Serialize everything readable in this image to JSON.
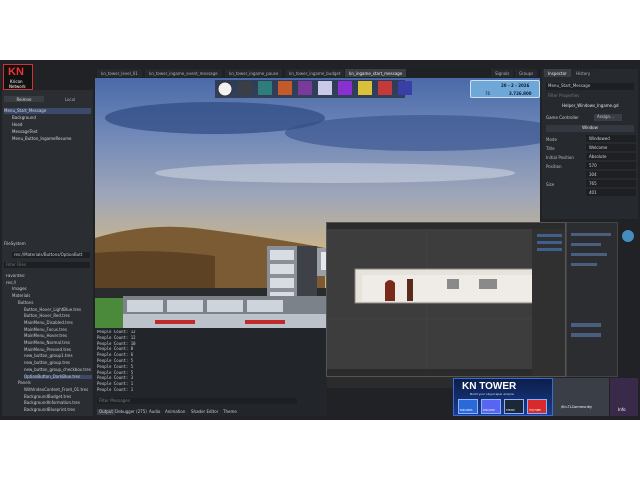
{
  "logo": {
    "line1": "KN",
    "line2": "Kricon",
    "line3": "Network"
  },
  "scene_panel": {
    "tabs": [
      "Reimne",
      "Local"
    ],
    "items": [
      "Menu_Start_Message",
      "Background",
      "Hood",
      "MessageText",
      "Menu_Button_IngameResume"
    ]
  },
  "filesystem": {
    "title": "FileSystem",
    "path": "res://Materials/Buttons/OptionButt",
    "filter": "Filter Files",
    "items": [
      "Favorites:",
      "res://",
      "Images",
      "Materials",
      "Buttons",
      "Button_Hover_LightBlue.tres",
      "Button_Hover_Red.tres",
      "MainMenu_Disabled.tres",
      "MainMenu_Focus.tres",
      "MainMenu_Hover.tres",
      "MainMenu_Normal.tres",
      "MainMenu_Pressed.tres",
      "new_button_group1.tres",
      "new_button_group.tres",
      "new_button_group_checkbox.tres",
      "OptionButton_DarkBlue.tres",
      "Panels",
      "WithIndexContent_Front_01.tres",
      "BackgroundBudget.tres",
      "BackgroundInformation.tres",
      "BackgroundBlueprint.tres"
    ]
  },
  "editor_tabs": [
    "kn_tower_level_01",
    "kn_tower_ingame_event_message",
    "kn_tower_ingame_pause",
    "kn_tower_ingame_budget",
    "kn_ingame_start_message"
  ],
  "top_right_tabs": [
    "Signals",
    "Groups"
  ],
  "hud": {
    "date": "20 - 2 - 2026",
    "people": "76",
    "money": "3.726.800"
  },
  "output": {
    "lines": [
      "People Count: 12",
      "People Count: 12",
      "People Count: 10",
      "People Count: 8",
      "People Count: 6",
      "People Count: 5",
      "People Count: 5",
      "People Count: 5",
      "People Count: 3",
      "People Count: 1",
      "People Count: 1"
    ],
    "filter": "Filter Messages",
    "bottom_tabs": [
      "Output",
      "Debugger (275)",
      "Audio",
      "Animation",
      "Shader Editor",
      "Theme"
    ]
  },
  "inspector": {
    "tabs": [
      "Inspector",
      "History"
    ],
    "node": "Menu_Start_Message",
    "filter": "Filter Properties",
    "script": "Helper_Windows_Ingame.gd",
    "game_controller_label": "Game Controller",
    "assign": "Assign...",
    "section": "Window",
    "rows": [
      {
        "label": "Mode",
        "value": "Windowed"
      },
      {
        "label": "Title",
        "value": "Welcome"
      },
      {
        "label": "Initial Position",
        "value": "Absolute"
      },
      {
        "label": "Position",
        "value": "570"
      },
      {
        "label": "",
        "value": "304"
      },
      {
        "label": "Size",
        "value": "765"
      },
      {
        "label": "",
        "value": "401"
      }
    ]
  },
  "banner": {
    "title": "KN TOWER",
    "subtitle": "Build your skyscraper empire",
    "buttons": [
      "BUILDERS",
      "DISCORD",
      "STEAM",
      "YOUTUBE"
    ],
    "handle": "/Kn-TLCommunity"
  },
  "corner_label": "Info",
  "colors": {
    "accent": "#33c7d8",
    "sky_top": "#5b7fb5",
    "sky_mid": "#a8b0c2",
    "sand": "#d8b56a",
    "building": "#9aa0a8"
  }
}
